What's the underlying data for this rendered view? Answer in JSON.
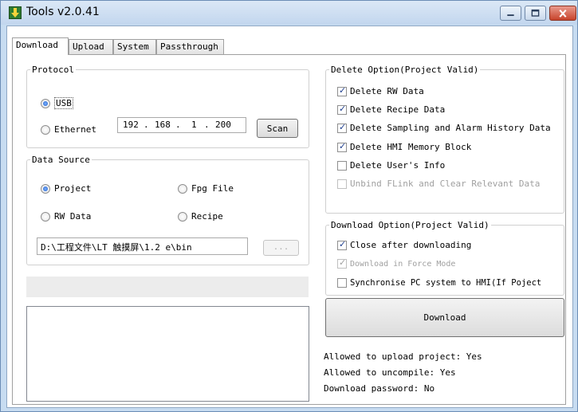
{
  "window": {
    "title": "Tools v2.0.41"
  },
  "tabs": [
    "Download",
    "Upload",
    "System",
    "Passthrough"
  ],
  "protocol": {
    "legend": "Protocol",
    "usb_label": "USB",
    "ethernet_label": "Ethernet",
    "selected": "USB",
    "ip": [
      "192",
      "168",
      "1",
      "200"
    ],
    "scan_label": "Scan"
  },
  "data_source": {
    "legend": "Data Source",
    "options": [
      "Project",
      "Fpg File",
      "RW Data",
      "Recipe"
    ],
    "selected": "Project",
    "path": "D:\\工程文件\\LT 触摸屏\\1.2 e\\bin",
    "browse_label": "..."
  },
  "delete_option": {
    "legend": "Delete Option(Project Valid)",
    "items": [
      {
        "label": "Delete RW Data",
        "checked": "true",
        "enabled": "true"
      },
      {
        "label": "Delete Recipe Data",
        "checked": "true",
        "enabled": "true"
      },
      {
        "label": "Delete Sampling and Alarm History Data",
        "checked": "true",
        "enabled": "true"
      },
      {
        "label": "Delete HMI Memory Block",
        "checked": "true",
        "enabled": "true"
      },
      {
        "label": "Delete User's Info",
        "checked": "false",
        "enabled": "true"
      },
      {
        "label": "Unbind FLink and Clear Relevant Data",
        "checked": "false",
        "enabled": "false"
      }
    ]
  },
  "download_option": {
    "legend": "Download Option(Project Valid)",
    "items": [
      {
        "label": "Close after downloading",
        "checked": "true",
        "enabled": "true"
      },
      {
        "label": "Download in Force Mode",
        "checked": "true",
        "enabled": "false"
      },
      {
        "label": "Synchronise PC system to HMI(If Poject",
        "checked": "false",
        "enabled": "true"
      }
    ]
  },
  "download_button": "Download",
  "info": [
    "Allowed to upload project: Yes",
    "Allowed to uncompile: Yes",
    "Download password: No"
  ]
}
